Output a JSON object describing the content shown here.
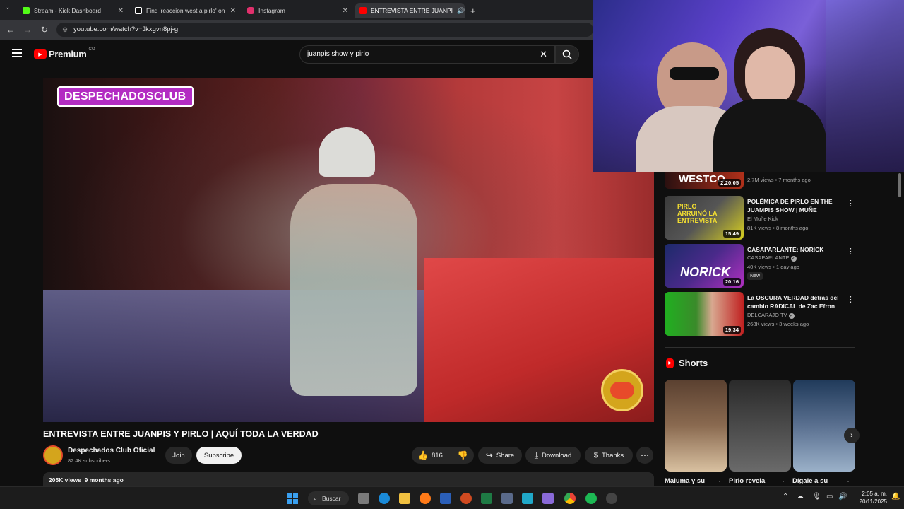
{
  "browser": {
    "tabs": [
      {
        "label": "Stream - Kick Dashboard",
        "color": "#53fc18"
      },
      {
        "label": "Find 'reaccion west a pirlo' on",
        "color": "#ffffff"
      },
      {
        "label": "Instagram",
        "color": "#e1306c"
      },
      {
        "label": "ENTREVISTA ENTRE JUANPI",
        "color": "#ff0000"
      }
    ],
    "new_tab": "+",
    "url": "youtube.com/watch?v=Jkxgvn8pj-g"
  },
  "youtube": {
    "logo_text": "Premium",
    "region": "CO",
    "search_value": "juanpis show y pirlo"
  },
  "video": {
    "overlay_label": "DESPECHADOSCLUB",
    "title": "ENTREVISTA ENTRE JUANPIS Y PIRLO | AQUÍ TODA LA VERDAD",
    "channel": "Despechados Club Oficial",
    "subscribers": "82.4K subscribers",
    "join": "Join",
    "subscribe": "Subscribe",
    "likes": "816",
    "share": "Share",
    "download": "Download",
    "thanks": "Thanks",
    "views": "205K views",
    "date": "9 months ago"
  },
  "recommendations": [
    {
      "thumb_text": "WESTCO",
      "duration": "2:20:05",
      "title": "",
      "channel": "",
      "meta": "2.7M views • 7 months ago",
      "badge": "",
      "colors": [
        "#2a1010",
        "#b0301a"
      ]
    },
    {
      "thumb_text": "PIRLO ARRUINÓ LA ENTREVISTA",
      "duration": "15:49",
      "title": "POLÉMICA DE PIRLO EN THE JUAMPIS SHOW | MUÑE",
      "channel": "El Muñe Kick",
      "meta": "81K views • 8 months ago",
      "badge": "",
      "colors": [
        "#3a3a3a",
        "#d8d020"
      ]
    },
    {
      "thumb_text": "NORICK",
      "duration": "20:16",
      "title": "CASAPARLANTE: NORICK",
      "channel": "CASAPARLANTE",
      "meta": "40K views • 1 day ago",
      "badge": "New",
      "colors": [
        "#1c2a6a",
        "#b030c0"
      ]
    },
    {
      "thumb_text": "",
      "duration": "19:34",
      "title": "La OSCURA VERDAD detrás del cambio RADICAL de Zac Efron",
      "channel": "DELCARAJO TV",
      "meta": "268K views • 3 weeks ago",
      "badge": "",
      "colors": [
        "#20b020",
        "#c02020"
      ]
    }
  ],
  "shorts": {
    "heading": "Shorts",
    "items": [
      {
        "title": "Maluma y su",
        "colors": [
          "#5a4030",
          "#d8c0a0"
        ]
      },
      {
        "title": "Pirlo revela",
        "colors": [
          "#2a2a2a",
          "#6a6a6a"
        ]
      },
      {
        "title": "Dígale a su",
        "colors": [
          "#203a5a",
          "#9ab0c8"
        ]
      }
    ]
  },
  "taskbar": {
    "search_label": "Buscar",
    "time": "2:05 a. m.",
    "date": "20/11/2025"
  }
}
